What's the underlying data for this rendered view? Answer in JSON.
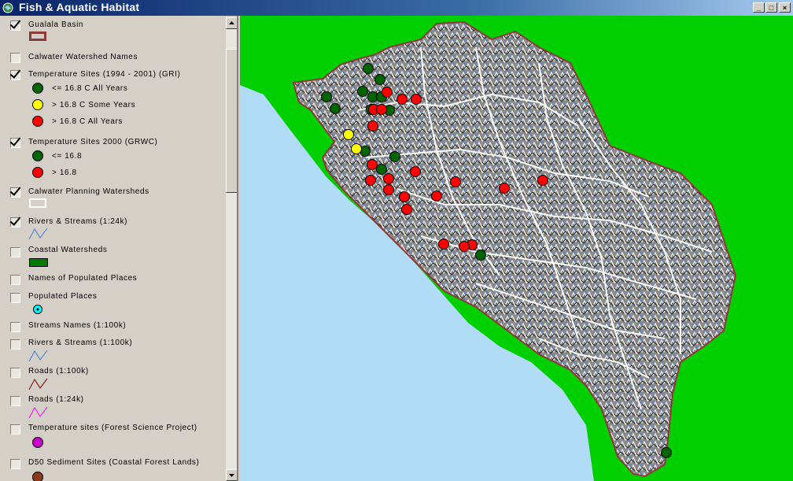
{
  "window": {
    "title": "Fish & Aquatic Habitat",
    "minimize_label": "_",
    "maximize_label": "□",
    "close_label": "×"
  },
  "legend": {
    "layers": [
      {
        "name": "Gualala Basin",
        "checked": true,
        "classes": [
          {
            "symbol": "basin-outline-swatch",
            "label": ""
          }
        ]
      },
      {
        "name": "Calwater Watershed Names",
        "checked": false,
        "classes": []
      },
      {
        "name": "Temperature Sites (1994 - 2001) (GRI)",
        "checked": true,
        "classes": [
          {
            "symbol": "green-circle",
            "label": "<= 16.8 C All Years"
          },
          {
            "symbol": "yellow-circle",
            "label": "> 16.8 C Some Years"
          },
          {
            "symbol": "red-circle",
            "label": "> 16.8 C All Years"
          }
        ]
      },
      {
        "name": "Temperature Sites 2000 (GRWC)",
        "checked": true,
        "classes": [
          {
            "symbol": "green-circle",
            "label": "<= 16.8"
          },
          {
            "symbol": "red-circle",
            "label": "> 16.8"
          }
        ]
      },
      {
        "name": "Calwater Planning Watersheds",
        "checked": true,
        "classes": [
          {
            "symbol": "white-polygon-swatch",
            "label": ""
          }
        ]
      },
      {
        "name": "Rivers & Streams (1:24k)",
        "checked": true,
        "classes": [
          {
            "symbol": "blue-line-swatch",
            "label": ""
          }
        ]
      },
      {
        "name": "Coastal Watersheds",
        "checked": false,
        "classes": [
          {
            "symbol": "green-fill-swatch",
            "label": ""
          }
        ]
      },
      {
        "name": "Names of Populated Places",
        "checked": false,
        "classes": []
      },
      {
        "name": "Populated Places",
        "checked": false,
        "classes": [
          {
            "symbol": "cyan-dot-swatch",
            "label": ""
          }
        ]
      },
      {
        "name": "Streams Names (1:100k)",
        "checked": false,
        "classes": []
      },
      {
        "name": "Rivers & Streams (1:100k)",
        "checked": false,
        "classes": [
          {
            "symbol": "blue-line-swatch",
            "label": ""
          }
        ]
      },
      {
        "name": "Roads (1:100k)",
        "checked": false,
        "classes": [
          {
            "symbol": "brown-line-swatch",
            "label": ""
          }
        ]
      },
      {
        "name": "Roads (1:24k)",
        "checked": false,
        "classes": [
          {
            "symbol": "magenta-line-swatch",
            "label": ""
          }
        ]
      },
      {
        "name": "Temperature sites (Forest Science Project)",
        "checked": false,
        "classes": [
          {
            "symbol": "magenta-circle",
            "label": ""
          }
        ]
      },
      {
        "name": "D50 Sediment Sites (Coastal Forest Lands)",
        "checked": false,
        "classes": [
          {
            "symbol": "brown-circle",
            "label": ""
          }
        ]
      }
    ]
  },
  "map": {
    "colors": {
      "background_land": "#00d000",
      "ocean": "#b0dcf6",
      "basin_outline": "#8b3a3a",
      "watershed_lines": "#ffffff",
      "streams": "#3c78d8",
      "site_green": "#006400",
      "site_yellow": "#ffff00",
      "site_red": "#ff0000"
    },
    "sites": [
      {
        "category": "green",
        "label": ""
      },
      {
        "category": "green",
        "label": ""
      },
      {
        "category": "green",
        "label": ""
      },
      {
        "category": "green",
        "label": ""
      },
      {
        "category": "green",
        "label": ""
      },
      {
        "category": "green",
        "label": ""
      },
      {
        "category": "green",
        "label": ""
      },
      {
        "category": "green",
        "label": ""
      },
      {
        "category": "green",
        "label": ""
      },
      {
        "category": "green",
        "label": ""
      },
      {
        "category": "green",
        "label": ""
      },
      {
        "category": "green",
        "label": ""
      },
      {
        "category": "green",
        "label": ""
      },
      {
        "category": "yellow",
        "label": ""
      },
      {
        "category": "yellow",
        "label": ""
      },
      {
        "category": "red",
        "label": ""
      },
      {
        "category": "red",
        "label": ""
      },
      {
        "category": "red",
        "label": ""
      },
      {
        "category": "red",
        "label": ""
      },
      {
        "category": "red",
        "label": ""
      },
      {
        "category": "red",
        "label": ""
      },
      {
        "category": "red",
        "label": ""
      },
      {
        "category": "red",
        "label": ""
      },
      {
        "category": "red",
        "label": ""
      },
      {
        "category": "red",
        "label": ""
      },
      {
        "category": "red",
        "label": ""
      },
      {
        "category": "red",
        "label": ""
      },
      {
        "category": "red",
        "label": ""
      },
      {
        "category": "red",
        "label": ""
      },
      {
        "category": "red",
        "label": ""
      },
      {
        "category": "red",
        "label": ""
      },
      {
        "category": "red",
        "label": ""
      },
      {
        "category": "red",
        "label": ""
      },
      {
        "category": "red",
        "label": ""
      },
      {
        "category": "red",
        "label": ""
      }
    ]
  }
}
